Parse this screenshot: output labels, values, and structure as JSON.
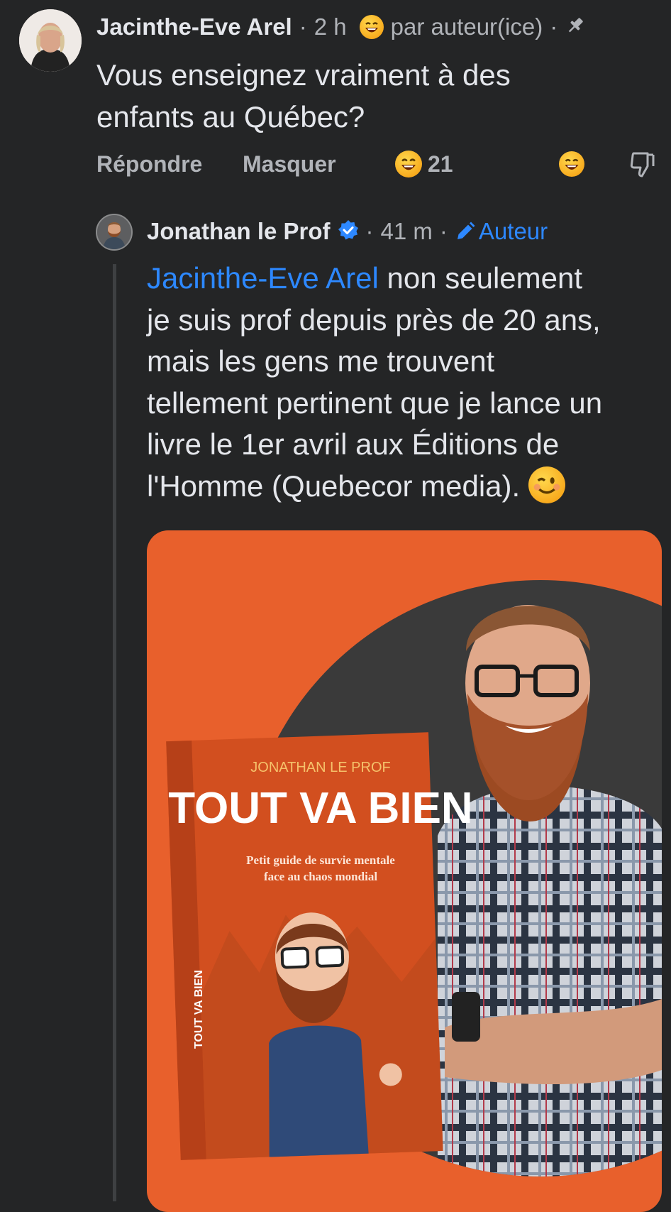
{
  "comment": {
    "author": "Jacinthe-Eve Arel",
    "meta_sep1": "·",
    "time": "2 h",
    "badge_label": "par auteur(ice)",
    "meta_sep2": "·",
    "text_line1": "Vous enseignez vraiment à des",
    "text_line2": "enfants au Québec?",
    "actions": {
      "reply": "Répondre",
      "hide": "Masquer",
      "reaction_count": "21"
    },
    "icons": [
      "laughing-emoji",
      "pin-icon",
      "thumbs-down-icon"
    ]
  },
  "reply": {
    "author": "Jonathan le Prof",
    "meta_sep1": "·",
    "time": "41 m",
    "meta_sep2": "·",
    "author_badge": "Auteur",
    "mention": "Jacinthe-Eve Arel",
    "lines": [
      " non seulement",
      "je suis prof depuis près de 20 ans,",
      "mais les gens me trouvent",
      "tellement pertinent que je lance un",
      "livre le 1er avril aux Éditions de",
      "l'Homme (Quebecor media). "
    ],
    "emoji": "😉",
    "book": {
      "author_line": "JONATHAN LE PROF",
      "title": "TOUT VA BIEN",
      "subtitle_line1": "Petit guide de survie mentale",
      "subtitle_line2": "face au chaos mondial",
      "spine": "TOUT VA BIEN"
    }
  },
  "colors": {
    "background": "#242526",
    "text": "#e4e6eb",
    "muted": "#b0b3b8",
    "mention": "#2d88ff",
    "photo_orange": "#e8602c"
  }
}
